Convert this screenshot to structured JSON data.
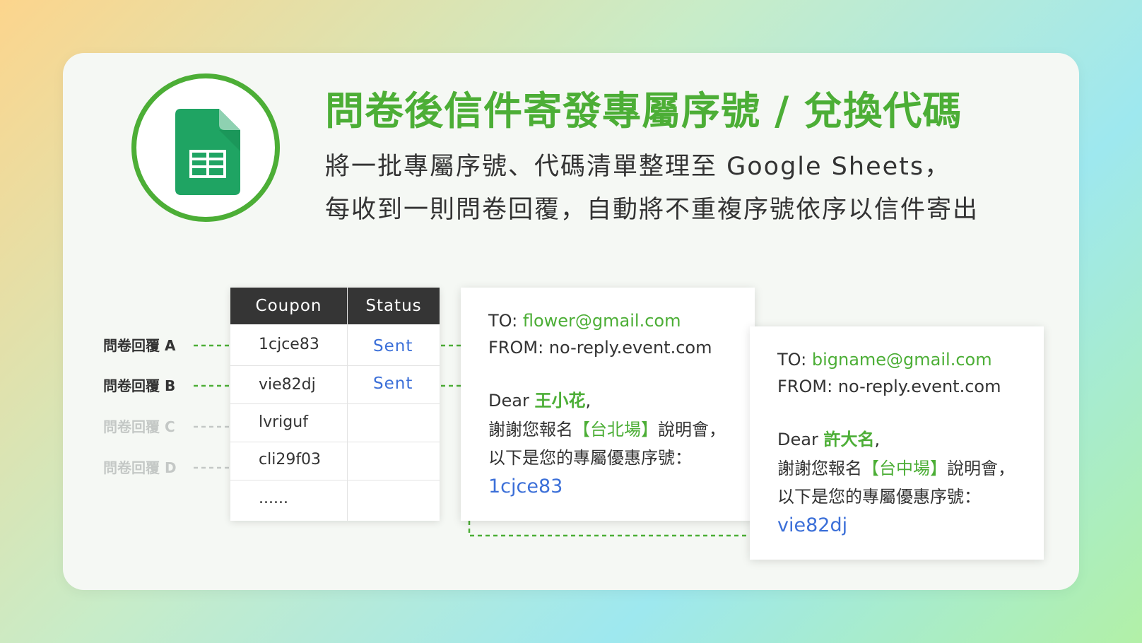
{
  "header": {
    "title": "問卷後信件寄發專屬序號 / 兌換代碼",
    "subtitle_line1": "將一批專屬序號、代碼清單整理至 Google Sheets，",
    "subtitle_line2": "每收到一則問卷回覆，自動將不重複序號依序以信件寄出",
    "logo_icon": "google-sheets-icon"
  },
  "responses": [
    {
      "label": "問卷回覆 A",
      "active": true
    },
    {
      "label": "問卷回覆 B",
      "active": true
    },
    {
      "label": "問卷回覆 C",
      "active": false
    },
    {
      "label": "問卷回覆 D",
      "active": false
    }
  ],
  "table": {
    "headers": {
      "coupon": "Coupon",
      "status": "Status"
    },
    "rows": [
      {
        "coupon": "1cjce83",
        "status": "Sent"
      },
      {
        "coupon": "vie82dj",
        "status": "Sent"
      },
      {
        "coupon": "lvriguf",
        "status": ""
      },
      {
        "coupon": "cli29f03",
        "status": ""
      },
      {
        "coupon": "......",
        "status": ""
      }
    ]
  },
  "emails": [
    {
      "to_label": "TO: ",
      "to": "flower@gmail.com",
      "from": "FROM: no-reply.event.com",
      "dear": "Dear ",
      "name": "王小花",
      "comma": ",",
      "line1_pre": "謝謝您報名",
      "event": "【台北場】",
      "line1_post": "說明會，",
      "line2": "以下是您的專屬優惠序號：",
      "code": "1cjce83"
    },
    {
      "to_label": "TO: ",
      "to": "bigname@gmail.com",
      "from": "FROM: no-reply.event.com",
      "dear": "Dear ",
      "name": "許大名",
      "comma": ",",
      "line1_pre": "謝謝您報名",
      "event": "【台中場】",
      "line1_post": "說明會，",
      "line2": "以下是您的專屬優惠序號：",
      "code": "vie82dj"
    }
  ],
  "colors": {
    "brand_green": "#4cae36",
    "link_blue": "#3b6fd8",
    "header_dark": "#353535",
    "dim_gray": "#c4c8c6"
  }
}
